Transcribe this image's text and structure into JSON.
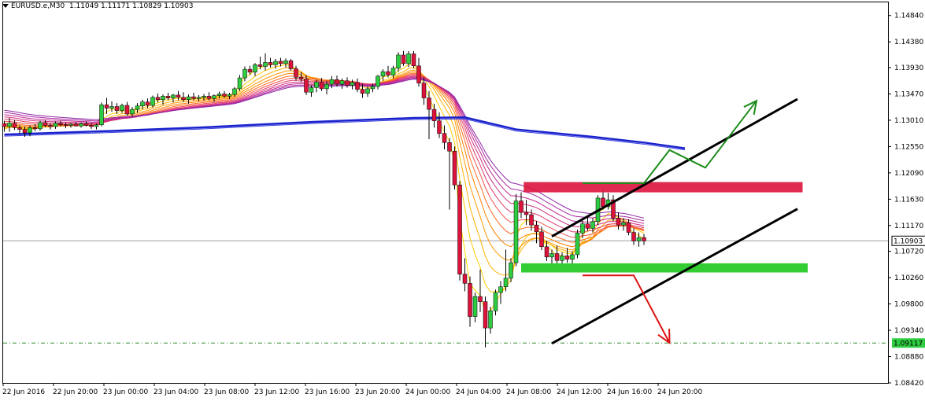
{
  "header": {
    "symbol": "EURUSD.e,M30",
    "ohlc": "1.11049 1.11171 1.10829 1.10903",
    "menu_icon": "triangle-down-icon"
  },
  "chart_data": {
    "type": "candlestick",
    "ylim": [
      1.0842,
      1.1507
    ],
    "y_ticks": [
      "1.14840",
      "1.14380",
      "1.13930",
      "1.13470",
      "1.13010",
      "1.12550",
      "1.12090",
      "1.11630",
      "1.11170",
      "1.10720",
      "1.10260",
      "1.09800",
      "1.09340",
      "1.08880",
      "1.08420"
    ],
    "x_ticks": [
      "22 Jun 2016",
      "22 Jun 20:00",
      "23 Jun 00:00",
      "23 Jun 04:00",
      "23 Jun 08:00",
      "23 Jun 12:00",
      "23 Jun 16:00",
      "23 Jun 20:00",
      "24 Jun 00:00",
      "24 Jun 04:00",
      "24 Jun 08:00",
      "24 Jun 12:00",
      "24 Jun 16:00",
      "24 Jun 20:00"
    ],
    "current_price": "1.10903",
    "support_price": "1.09117",
    "colors": {
      "bull": "#2ecc40",
      "bear": "#dc143c",
      "ma_slow": "#1a22cc",
      "channel": "#000000",
      "resistance_zone": "#dc143c",
      "support_zone": "#33cc33",
      "up_arrow": "#1a8c1a",
      "down_arrow": "#dd1111",
      "support_line": "#2a8a2a"
    },
    "resistance_zone": [
      1.1175,
      1.1193
    ],
    "support_zone": [
      1.1035,
      1.1051
    ],
    "candles": [
      [
        1.1295,
        1.13,
        1.1281,
        1.129
      ],
      [
        1.129,
        1.1305,
        1.1281,
        1.1296
      ],
      [
        1.1296,
        1.1301,
        1.1284,
        1.1288
      ],
      [
        1.1288,
        1.1292,
        1.1278,
        1.1285
      ],
      [
        1.1285,
        1.129,
        1.1272,
        1.1279
      ],
      [
        1.1279,
        1.1292,
        1.1273,
        1.1288
      ],
      [
        1.1288,
        1.1294,
        1.1282,
        1.1286
      ],
      [
        1.1286,
        1.13,
        1.1283,
        1.1297
      ],
      [
        1.1297,
        1.1301,
        1.1289,
        1.1292
      ],
      [
        1.1292,
        1.1296,
        1.1285,
        1.129
      ],
      [
        1.129,
        1.1299,
        1.1286,
        1.1296
      ],
      [
        1.1296,
        1.13,
        1.129,
        1.1293
      ],
      [
        1.1293,
        1.1297,
        1.1287,
        1.1292
      ],
      [
        1.1292,
        1.1296,
        1.1288,
        1.1294
      ],
      [
        1.1294,
        1.1298,
        1.129,
        1.1291
      ],
      [
        1.1291,
        1.1297,
        1.1288,
        1.1295
      ],
      [
        1.1295,
        1.1299,
        1.129,
        1.1292
      ],
      [
        1.1292,
        1.1296,
        1.1286,
        1.129
      ],
      [
        1.129,
        1.1295,
        1.1285,
        1.1293
      ],
      [
        1.1293,
        1.1332,
        1.129,
        1.1328
      ],
      [
        1.1328,
        1.134,
        1.1312,
        1.1322
      ],
      [
        1.1322,
        1.1334,
        1.1316,
        1.1325
      ],
      [
        1.1325,
        1.1331,
        1.1312,
        1.1318
      ],
      [
        1.1318,
        1.133,
        1.1314,
        1.1327
      ],
      [
        1.1327,
        1.1333,
        1.1309,
        1.1312
      ],
      [
        1.1312,
        1.1324,
        1.1308,
        1.132
      ],
      [
        1.132,
        1.1331,
        1.1314,
        1.1326
      ],
      [
        1.1326,
        1.1337,
        1.132,
        1.1333
      ],
      [
        1.1333,
        1.1339,
        1.1322,
        1.1327
      ],
      [
        1.1327,
        1.1344,
        1.1323,
        1.1341
      ],
      [
        1.1341,
        1.1348,
        1.1332,
        1.1337
      ],
      [
        1.1337,
        1.1346,
        1.1328,
        1.1343
      ],
      [
        1.1343,
        1.1349,
        1.1336,
        1.134
      ],
      [
        1.134,
        1.1347,
        1.1332,
        1.1345
      ],
      [
        1.1345,
        1.1352,
        1.1336,
        1.1341
      ],
      [
        1.1341,
        1.135,
        1.1333,
        1.1337
      ],
      [
        1.1337,
        1.1346,
        1.133,
        1.1342
      ],
      [
        1.1342,
        1.1349,
        1.1336,
        1.1339
      ],
      [
        1.1339,
        1.1345,
        1.1334,
        1.1341
      ],
      [
        1.1341,
        1.1347,
        1.1335,
        1.1343
      ],
      [
        1.1343,
        1.135,
        1.1336,
        1.1339
      ],
      [
        1.1339,
        1.1346,
        1.1333,
        1.1344
      ],
      [
        1.1344,
        1.1351,
        1.1339,
        1.1347
      ],
      [
        1.1347,
        1.1352,
        1.134,
        1.1343
      ],
      [
        1.1343,
        1.1349,
        1.1338,
        1.1346
      ],
      [
        1.1346,
        1.1359,
        1.1342,
        1.1356
      ],
      [
        1.1356,
        1.138,
        1.1352,
        1.1375
      ],
      [
        1.1375,
        1.1395,
        1.1369,
        1.139
      ],
      [
        1.139,
        1.1396,
        1.138,
        1.1385
      ],
      [
        1.1385,
        1.1401,
        1.1378,
        1.1398
      ],
      [
        1.1398,
        1.1412,
        1.139,
        1.1395
      ],
      [
        1.1395,
        1.1418,
        1.1388,
        1.1402
      ],
      [
        1.1402,
        1.141,
        1.1393,
        1.1398
      ],
      [
        1.1398,
        1.1408,
        1.1391,
        1.1404
      ],
      [
        1.1404,
        1.141,
        1.1395,
        1.14
      ],
      [
        1.14,
        1.1409,
        1.1393,
        1.1405
      ],
      [
        1.1405,
        1.1408,
        1.1388,
        1.1391
      ],
      [
        1.1391,
        1.1396,
        1.137,
        1.1376
      ],
      [
        1.1376,
        1.1385,
        1.1368,
        1.1373
      ],
      [
        1.1373,
        1.138,
        1.1345,
        1.135
      ],
      [
        1.135,
        1.1362,
        1.1342,
        1.1358
      ],
      [
        1.1358,
        1.1372,
        1.135,
        1.1368
      ],
      [
        1.1368,
        1.1375,
        1.1352,
        1.1356
      ],
      [
        1.1356,
        1.137,
        1.1346,
        1.1364
      ],
      [
        1.1364,
        1.1378,
        1.1357,
        1.1372
      ],
      [
        1.1372,
        1.1379,
        1.136,
        1.1364
      ],
      [
        1.1364,
        1.1374,
        1.1356,
        1.137
      ],
      [
        1.137,
        1.1376,
        1.1358,
        1.1362
      ],
      [
        1.1362,
        1.1372,
        1.1355,
        1.1367
      ],
      [
        1.1367,
        1.1374,
        1.135,
        1.1355
      ],
      [
        1.1355,
        1.1365,
        1.134,
        1.1348
      ],
      [
        1.1348,
        1.136,
        1.1342,
        1.1356
      ],
      [
        1.1356,
        1.1365,
        1.135,
        1.136
      ],
      [
        1.136,
        1.138,
        1.1355,
        1.1378
      ],
      [
        1.1378,
        1.139,
        1.137,
        1.1386
      ],
      [
        1.1386,
        1.1396,
        1.1376,
        1.138
      ],
      [
        1.138,
        1.1396,
        1.1374,
        1.1392
      ],
      [
        1.1392,
        1.142,
        1.1386,
        1.1415
      ],
      [
        1.1415,
        1.1422,
        1.1396,
        1.14
      ],
      [
        1.14,
        1.1422,
        1.1394,
        1.1417
      ],
      [
        1.1417,
        1.1422,
        1.1392,
        1.1396
      ],
      [
        1.1396,
        1.141,
        1.136,
        1.1366
      ],
      [
        1.1366,
        1.1376,
        1.1328,
        1.134
      ],
      [
        1.134,
        1.1352,
        1.1268,
        1.132
      ],
      [
        1.132,
        1.133,
        1.1288,
        1.13
      ],
      [
        1.13,
        1.1315,
        1.127,
        1.1278
      ],
      [
        1.1278,
        1.1292,
        1.125,
        1.1262
      ],
      [
        1.1262,
        1.127,
        1.1145,
        1.1247
      ],
      [
        1.1247,
        1.1255,
        1.118,
        1.1188
      ],
      [
        1.1188,
        1.1195,
        1.1021,
        1.1032
      ],
      [
        1.1032,
        1.106,
        1.1002,
        1.1016
      ],
      [
        1.1016,
        1.1028,
        1.094,
        1.0958
      ],
      [
        1.0958,
        1.1,
        1.0948,
        1.0993
      ],
      [
        1.0993,
        1.104,
        1.0966,
        1.0984
      ],
      [
        1.0984,
        1.0993,
        1.0904,
        1.0938
      ],
      [
        1.0938,
        1.0975,
        1.0928,
        1.0968
      ],
      [
        1.0968,
        1.1005,
        1.096,
        1.1
      ],
      [
        1.1,
        1.102,
        1.098,
        1.101
      ],
      [
        1.101,
        1.1075,
        1.1002,
        1.1025
      ],
      [
        1.1025,
        1.106,
        1.1018,
        1.1052
      ],
      [
        1.1052,
        1.1172,
        1.1046,
        1.116
      ],
      [
        1.116,
        1.1175,
        1.113,
        1.114
      ],
      [
        1.114,
        1.1162,
        1.1118,
        1.1136
      ],
      [
        1.1136,
        1.1145,
        1.1108,
        1.1118
      ],
      [
        1.1118,
        1.1125,
        1.1086,
        1.1106
      ],
      [
        1.1106,
        1.1115,
        1.1074,
        1.108
      ],
      [
        1.108,
        1.109,
        1.1055,
        1.1062
      ],
      [
        1.1062,
        1.1075,
        1.105,
        1.1068
      ],
      [
        1.1068,
        1.1082,
        1.105,
        1.1056
      ],
      [
        1.1056,
        1.107,
        1.105,
        1.1064
      ],
      [
        1.1064,
        1.1078,
        1.1052,
        1.1058
      ],
      [
        1.1058,
        1.1072,
        1.1049,
        1.1066
      ],
      [
        1.1066,
        1.111,
        1.106,
        1.1104
      ],
      [
        1.1104,
        1.1125,
        1.1095,
        1.112
      ],
      [
        1.112,
        1.1132,
        1.1108,
        1.1112
      ],
      [
        1.1112,
        1.113,
        1.1105,
        1.1124
      ],
      [
        1.1124,
        1.117,
        1.1118,
        1.1165
      ],
      [
        1.1165,
        1.1178,
        1.1145,
        1.115
      ],
      [
        1.115,
        1.1174,
        1.1145,
        1.1162
      ],
      [
        1.1162,
        1.117,
        1.1125,
        1.113
      ],
      [
        1.113,
        1.114,
        1.111,
        1.1118
      ],
      [
        1.1118,
        1.113,
        1.1108,
        1.1122
      ],
      [
        1.1122,
        1.1128,
        1.11,
        1.1105
      ],
      [
        1.1105,
        1.1112,
        1.1083,
        1.109
      ],
      [
        1.109,
        1.1105,
        1.108,
        1.1096
      ],
      [
        1.1096,
        1.1102,
        1.1083,
        1.109
      ]
    ],
    "ma_fast_bases": [
      1.1282,
      1.1284,
      1.1287,
      1.129,
      1.1293,
      1.1296,
      1.13,
      1.1304,
      1.1308,
      1.1312,
      1.1316,
      1.132
    ],
    "ma_slow": [
      [
        0,
        1.1276
      ],
      [
        20,
        1.1282
      ],
      [
        40,
        1.1289
      ],
      [
        60,
        1.1298
      ],
      [
        80,
        1.1305
      ],
      [
        90,
        1.1306
      ],
      [
        100,
        1.1285
      ],
      [
        115,
        1.1272
      ],
      [
        125,
        1.1262
      ],
      [
        133,
        1.1252
      ]
    ],
    "channel_upper": [
      [
        1.1098,
        -6
      ],
      [
        1.1338,
        42
      ]
    ],
    "channel_lower": [
      [
        1.0911,
        -6
      ],
      [
        1.1146,
        42
      ]
    ],
    "up_arrow": [
      [
        1.1191,
        0
      ],
      [
        1.1191,
        12
      ],
      [
        1.1249,
        17
      ],
      [
        1.1218,
        24
      ],
      [
        1.1335,
        34
      ]
    ],
    "down_arrow": [
      [
        1.103,
        0
      ],
      [
        1.103,
        10
      ],
      [
        1.0912,
        17
      ]
    ],
    "annotation_x_base": 113
  }
}
